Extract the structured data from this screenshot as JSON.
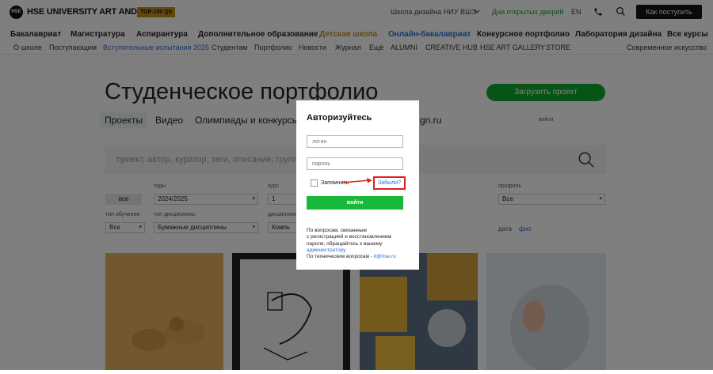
{
  "header": {
    "logo_mark": "HSE",
    "logo_text": "HSE UNIVERSITY ART AND DESIGN",
    "badge": "TOP-100 QS",
    "school_link": "Школа дизайна НИУ ВШЭ",
    "open_days": "Дни открытых дверей",
    "lang": "EN",
    "cta": "Как поступить"
  },
  "nav_primary": [
    "Бакалавриат",
    "Магистратура",
    "Аспирантура",
    "Дополнительное образование",
    "Детская школа",
    "Онлайн-бакалавриат",
    "Конкурсное портфолио",
    "Лаборатория дизайна",
    "Все курсы"
  ],
  "nav_secondary": [
    "О школе",
    "Поступающим",
    "Вступительные испытания 2025",
    "Студентам",
    "Портфолио",
    "Новости",
    "Журнал",
    "Ещё",
    "ALUMNI",
    "CREATIVE HUB",
    "HSE ART GALLERY",
    "STORE",
    "Современное искусство"
  ],
  "page": {
    "title": "Студенческое портфолио",
    "upload_button": "Загрузить проект",
    "tabs": [
      "Проекты",
      "Видео",
      "Олимпиады и конкурсы"
    ],
    "tab_partial": "gn.ru",
    "login_link": "войти",
    "search_placeholder": "проект, автор, куратор, теги, описание, групп"
  },
  "filters": {
    "all_button": "все",
    "year_label": "годы",
    "year_value": "2024/2025",
    "course_label": "курс",
    "course_value": "1",
    "direction_label": "профиль",
    "direction_value": "Все",
    "study_type_label": "тип обучения",
    "study_type_value": "Все",
    "discipline_type_label": "тип дисциплины",
    "discipline_type_value": "Бумажные дисциплины",
    "discipline_label": "дисциплина",
    "discipline_value": "Компь",
    "date_label": "дата",
    "date_value": "фио"
  },
  "modal": {
    "title": "Авторизуйтесь",
    "login_placeholder": "логин",
    "password_placeholder": "пароль",
    "remember": "Запомнить",
    "forgot": "Забыли?",
    "submit": "войти",
    "help_1": "По вопросам, связанным",
    "help_2": "с регистрацией и восстановлением",
    "help_3": "пароля, обращайтесь к вашему",
    "help_admin_link": "администратору",
    "help_4": "По техническим вопросам -",
    "help_email": "it@hse.ru"
  },
  "colors": {
    "accent_green": "#11a92e",
    "modal_button_green": "#18b83a",
    "highlight_red": "#d9231c",
    "link_blue": "#2c6ed5",
    "badge_gold": "#c98f1e"
  }
}
